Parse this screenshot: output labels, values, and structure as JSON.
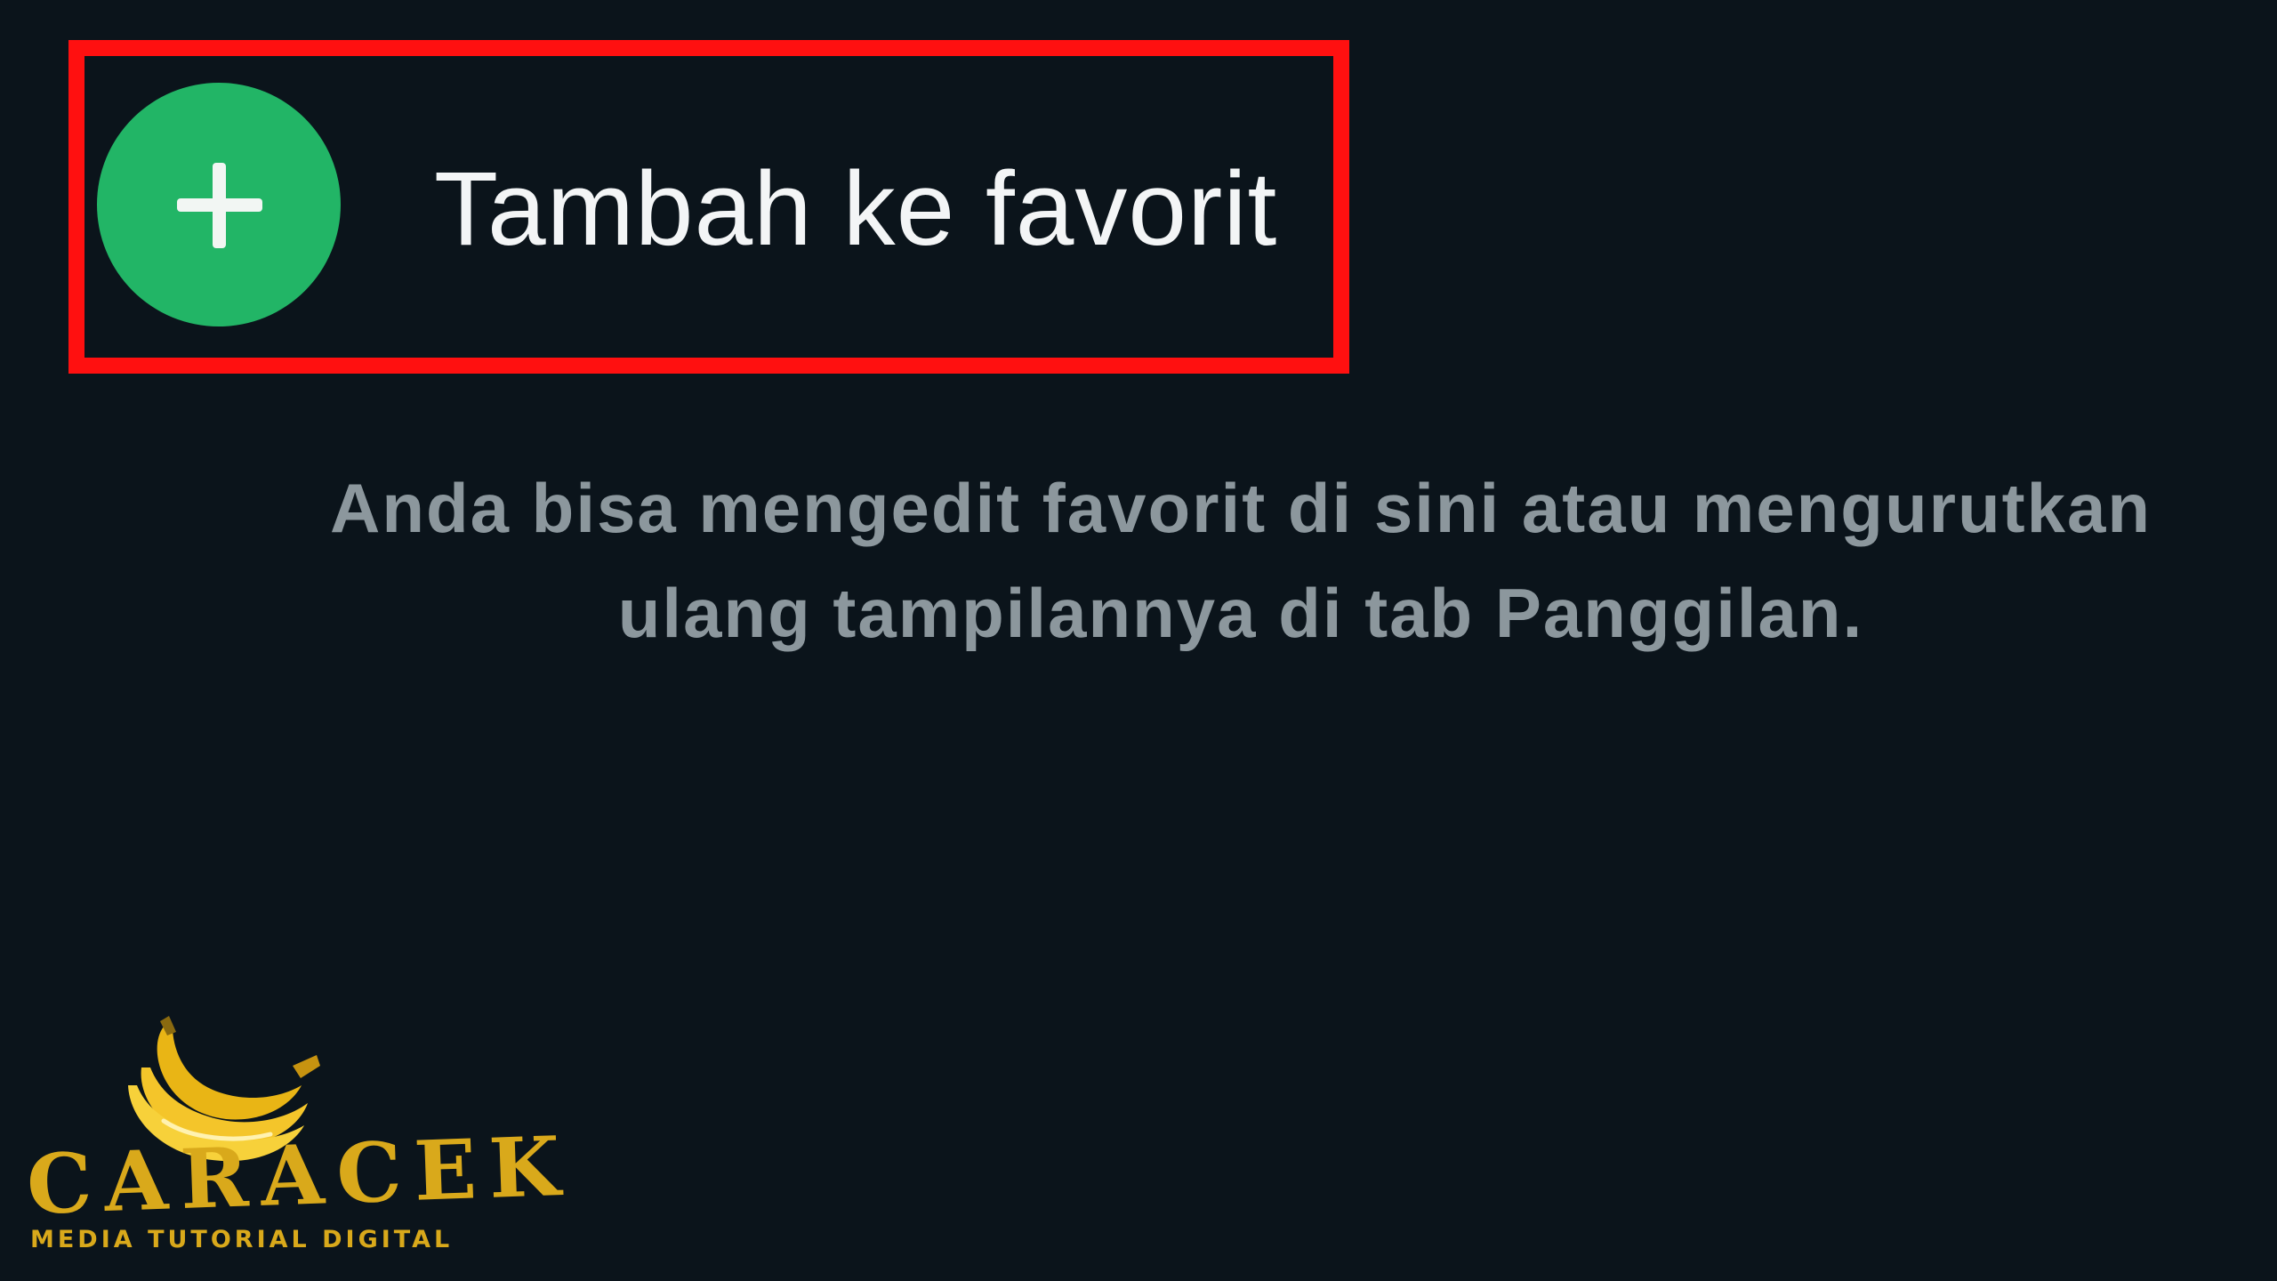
{
  "favorites": {
    "add_label": "Tambah ke favorit",
    "add_icon": "plus-icon",
    "info_lines": [
      "Anda bisa mengedit favorit di sini atau mengurutkan",
      "ulang tampilannya di tab Panggilan."
    ]
  },
  "watermark": {
    "brand": "CARACEK",
    "tagline": "MEDIA TUTORIAL DIGITAL",
    "icon": "banana-icon"
  },
  "colors": {
    "background": "#0b141b",
    "accent_green": "#22b566",
    "highlight_red": "#ff1010",
    "primary_text": "#f3f5f6",
    "secondary_text": "#8c979d",
    "brand_gold": "#d9a91b"
  }
}
